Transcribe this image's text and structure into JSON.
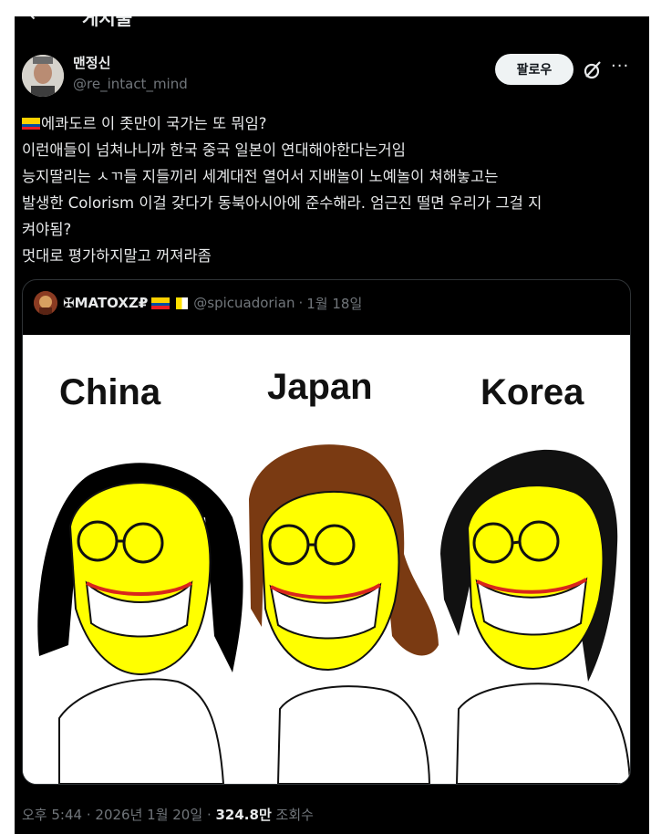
{
  "header": {
    "back_glyph": "←",
    "title": "게시물"
  },
  "post": {
    "author_name": "맨정신",
    "author_handle": "@re_intact_mind",
    "follow_label": "팔로우",
    "lines": [
      "에콰도르 이 좃만이 국가는 또 뭐임?",
      "이런애들이 넘쳐나니까 한국 중국 일본이 연대해야한다는거임",
      "능지딸리는 ㅅㄲ들 지들끼리 세계대전 열어서 지배놀이 노예놀이 쳐해놓고는",
      "발생한 Colorism 이걸 갖다가 동북아시아에 준수해라. 엄근진 떨면 우리가 그걸 지",
      "켜야됨?",
      "멋대로 평가하지말고 꺼져라좀"
    ],
    "flag_icon": "ecuador-flag-icon"
  },
  "quoted": {
    "author_name": "✠MATOXZ₽",
    "author_handle": "@spicuadorian",
    "dot": "·",
    "date": "1월 18일",
    "meme_labels": [
      "China",
      "Japan",
      "Korea"
    ]
  },
  "footer": {
    "time": "오후 5:44",
    "dot1": "·",
    "date": "2026년 1월 20일",
    "dot2": "·",
    "views": "324.8만",
    "views_label": "조회수"
  },
  "colors": {
    "bg": "#000000",
    "text": "#e7e9ea",
    "muted": "#71767b",
    "face": "#ffff00"
  }
}
